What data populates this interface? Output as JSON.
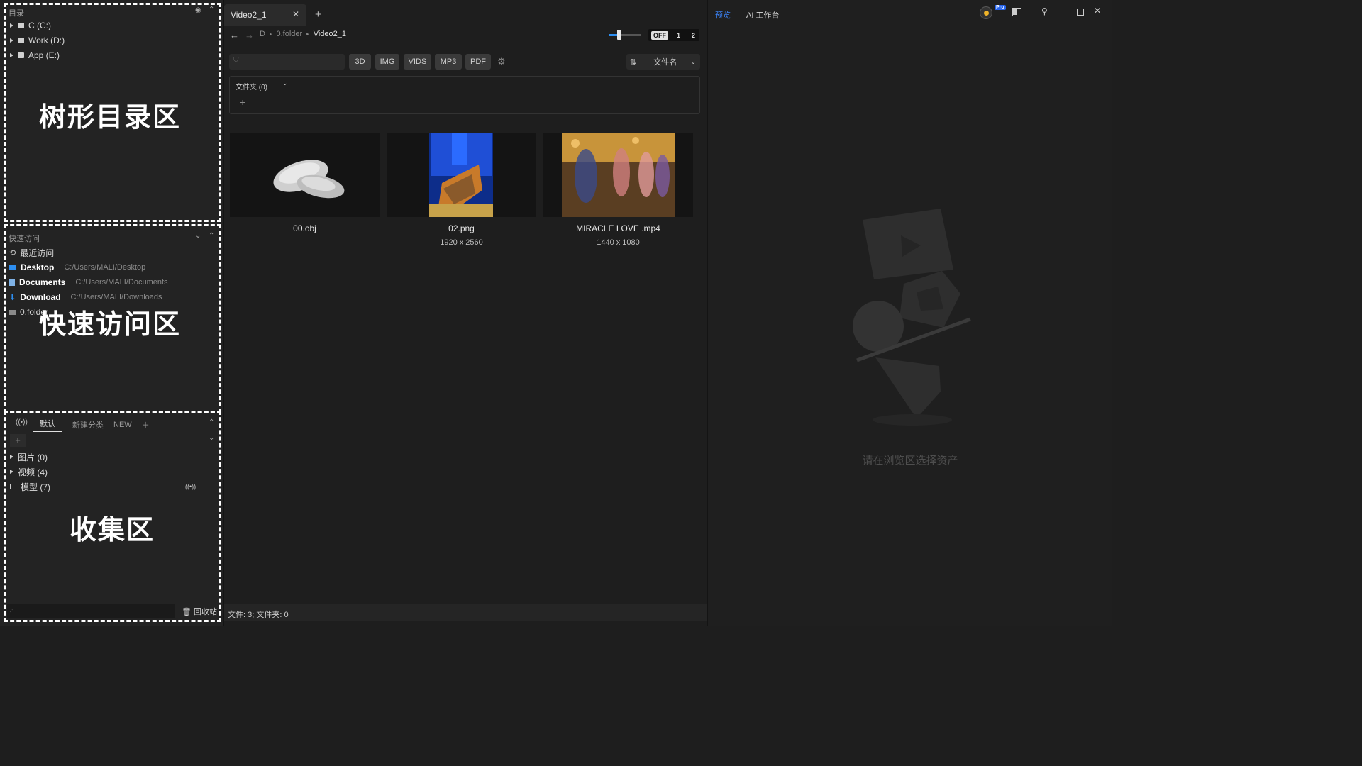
{
  "tree": {
    "header": "目录",
    "drives": [
      "C (C:)",
      "Work (D:)",
      "App (E:)"
    ],
    "overlay_label": "树形目录区"
  },
  "quick_access": {
    "header": "快速访问",
    "recent": "最近访问",
    "items": [
      {
        "name": "Desktop",
        "path": "C:/Users/MALI/Desktop"
      },
      {
        "name": "Documents",
        "path": "C:/Users/MALI/Documents"
      },
      {
        "name": "Download",
        "path": "C:/Users/MALI/Downloads"
      }
    ],
    "folder": "0.folder",
    "overlay_label": "快速访问区"
  },
  "collection": {
    "tabs": [
      "默认",
      "新建分类",
      "NEW"
    ],
    "groups": [
      "图片 (0)",
      "视频 (4)",
      "模型 (7)"
    ],
    "recycle": "回收站",
    "overlay_label": "收集区"
  },
  "browser": {
    "tab_title": "Video2_1",
    "breadcrumb": [
      "D",
      "0.folder",
      "Video2_1"
    ],
    "view_toggle": [
      "OFF",
      "1",
      "2"
    ],
    "filters": [
      "3D",
      "IMG",
      "VIDS",
      "MP3",
      "PDF"
    ],
    "sort_label": "文件名",
    "folder_section": "文件夹 (0)",
    "files": [
      {
        "name": "00.obj",
        "dims": ""
      },
      {
        "name": "02.png",
        "dims": "1920 x 2560"
      },
      {
        "name": "MIRACLE LOVE .mp4",
        "dims": "1440 x 1080"
      }
    ],
    "status": "文件: 3; 文件夹: 0"
  },
  "preview": {
    "tabs": [
      "预览",
      "AI 工作台"
    ],
    "badge": "Pro",
    "empty_text": "请在浏览区选择资产",
    "accent": "#3b82f6"
  }
}
